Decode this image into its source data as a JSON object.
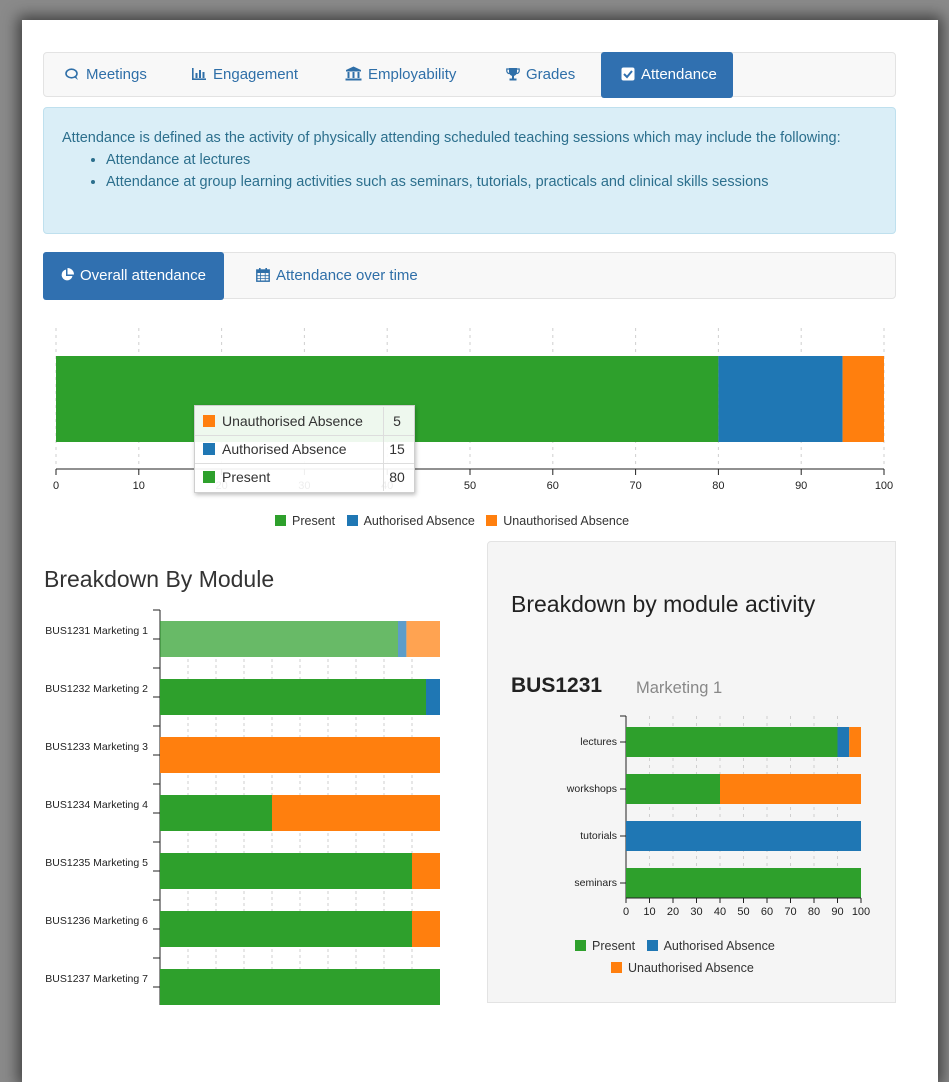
{
  "nav": {
    "tabs": [
      {
        "label": "Meetings",
        "icon": "chat-icon",
        "active": false
      },
      {
        "label": "Engagement",
        "icon": "bar-chart-icon",
        "active": false
      },
      {
        "label": "Employability",
        "icon": "institution-icon",
        "active": false
      },
      {
        "label": "Grades",
        "icon": "trophy-icon",
        "active": false
      },
      {
        "label": "Attendance",
        "icon": "check-square-icon",
        "active": true
      }
    ]
  },
  "info": {
    "text": "Attendance is defined as the activity of physically attending scheduled teaching sessions which may include the following:",
    "bullets": [
      "Attendance at lectures",
      "Attendance at group learning activities such as seminars, tutorials, practicals and clinical skills sessions"
    ]
  },
  "subtabs": [
    {
      "label": "Overall attendance",
      "icon": "pie-chart-icon",
      "active": true
    },
    {
      "label": "Attendance over time",
      "icon": "calendar-icon",
      "active": false
    }
  ],
  "colors": {
    "present": "#2ea02c",
    "authorised": "#1f77b4",
    "unauthorised": "#ff7f0e"
  },
  "legend": [
    "Present",
    "Authorised Absence",
    "Unauthorised Absence"
  ],
  "chart_data": [
    {
      "type": "bar",
      "orientation": "horizontal",
      "stacked": true,
      "series": [
        {
          "name": "Present",
          "values": [
            80
          ]
        },
        {
          "name": "Authorised Absence",
          "values": [
            15
          ]
        },
        {
          "name": "Unauthorised Absence",
          "values": [
            5
          ]
        }
      ],
      "xlim": [
        0,
        100
      ],
      "xticks": [
        0,
        10,
        20,
        30,
        40,
        50,
        60,
        70,
        80,
        90,
        100
      ],
      "legend_position": "bottom",
      "tooltip": [
        {
          "name": "Unauthorised Absence",
          "value": 5
        },
        {
          "name": "Authorised Absence",
          "value": 15
        },
        {
          "name": "Present",
          "value": 80
        }
      ]
    },
    {
      "type": "bar",
      "orientation": "horizontal",
      "stacked": true,
      "title": "Breakdown By Module",
      "categories": [
        "BUS1231 Marketing 1",
        "BUS1232 Marketing 2",
        "BUS1233 Marketing 3",
        "BUS1234 Marketing 4",
        "BUS1235 Marketing 5",
        "BUS1236 Marketing 6",
        "BUS1237 Marketing 7"
      ],
      "series": [
        {
          "name": "Present",
          "values": [
            85,
            95,
            0,
            40,
            90,
            90,
            100
          ]
        },
        {
          "name": "Authorised Absence",
          "values": [
            3,
            5,
            0,
            0,
            0,
            0,
            0
          ]
        },
        {
          "name": "Unauthorised Absence",
          "values": [
            12,
            0,
            100,
            60,
            10,
            10,
            0
          ]
        }
      ],
      "xlim": [
        0,
        100
      ],
      "highlighted_category": "BUS1231 Marketing 1"
    },
    {
      "type": "bar",
      "orientation": "horizontal",
      "stacked": true,
      "title": "Breakdown by module activity",
      "subtitle_code": "BUS1231",
      "subtitle_name": "Marketing 1",
      "categories": [
        "lectures",
        "workshops",
        "tutorials",
        "seminars"
      ],
      "series": [
        {
          "name": "Present",
          "values": [
            90,
            40,
            0,
            100
          ]
        },
        {
          "name": "Authorised Absence",
          "values": [
            5,
            0,
            100,
            0
          ]
        },
        {
          "name": "Unauthorised Absence",
          "values": [
            5,
            60,
            0,
            0
          ]
        }
      ],
      "xlim": [
        0,
        100
      ],
      "xticks": [
        0,
        10,
        20,
        30,
        40,
        50,
        60,
        70,
        80,
        90,
        100
      ],
      "legend_position": "bottom"
    }
  ]
}
